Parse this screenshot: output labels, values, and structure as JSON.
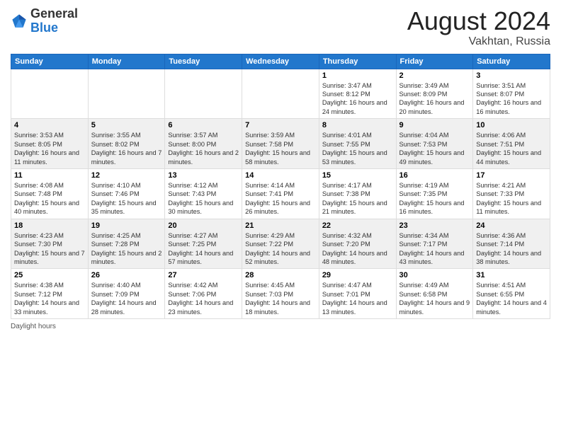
{
  "header": {
    "logo_general": "General",
    "logo_blue": "Blue",
    "month_year": "August 2024",
    "location": "Vakhtan, Russia"
  },
  "days_of_week": [
    "Sunday",
    "Monday",
    "Tuesday",
    "Wednesday",
    "Thursday",
    "Friday",
    "Saturday"
  ],
  "footer_label": "Daylight hours",
  "weeks": [
    [
      {
        "day": "",
        "info": ""
      },
      {
        "day": "",
        "info": ""
      },
      {
        "day": "",
        "info": ""
      },
      {
        "day": "",
        "info": ""
      },
      {
        "day": "1",
        "info": "Sunrise: 3:47 AM\nSunset: 8:12 PM\nDaylight: 16 hours and 24 minutes."
      },
      {
        "day": "2",
        "info": "Sunrise: 3:49 AM\nSunset: 8:09 PM\nDaylight: 16 hours and 20 minutes."
      },
      {
        "day": "3",
        "info": "Sunrise: 3:51 AM\nSunset: 8:07 PM\nDaylight: 16 hours and 16 minutes."
      }
    ],
    [
      {
        "day": "4",
        "info": "Sunrise: 3:53 AM\nSunset: 8:05 PM\nDaylight: 16 hours and 11 minutes."
      },
      {
        "day": "5",
        "info": "Sunrise: 3:55 AM\nSunset: 8:02 PM\nDaylight: 16 hours and 7 minutes."
      },
      {
        "day": "6",
        "info": "Sunrise: 3:57 AM\nSunset: 8:00 PM\nDaylight: 16 hours and 2 minutes."
      },
      {
        "day": "7",
        "info": "Sunrise: 3:59 AM\nSunset: 7:58 PM\nDaylight: 15 hours and 58 minutes."
      },
      {
        "day": "8",
        "info": "Sunrise: 4:01 AM\nSunset: 7:55 PM\nDaylight: 15 hours and 53 minutes."
      },
      {
        "day": "9",
        "info": "Sunrise: 4:04 AM\nSunset: 7:53 PM\nDaylight: 15 hours and 49 minutes."
      },
      {
        "day": "10",
        "info": "Sunrise: 4:06 AM\nSunset: 7:51 PM\nDaylight: 15 hours and 44 minutes."
      }
    ],
    [
      {
        "day": "11",
        "info": "Sunrise: 4:08 AM\nSunset: 7:48 PM\nDaylight: 15 hours and 40 minutes."
      },
      {
        "day": "12",
        "info": "Sunrise: 4:10 AM\nSunset: 7:46 PM\nDaylight: 15 hours and 35 minutes."
      },
      {
        "day": "13",
        "info": "Sunrise: 4:12 AM\nSunset: 7:43 PM\nDaylight: 15 hours and 30 minutes."
      },
      {
        "day": "14",
        "info": "Sunrise: 4:14 AM\nSunset: 7:41 PM\nDaylight: 15 hours and 26 minutes."
      },
      {
        "day": "15",
        "info": "Sunrise: 4:17 AM\nSunset: 7:38 PM\nDaylight: 15 hours and 21 minutes."
      },
      {
        "day": "16",
        "info": "Sunrise: 4:19 AM\nSunset: 7:35 PM\nDaylight: 15 hours and 16 minutes."
      },
      {
        "day": "17",
        "info": "Sunrise: 4:21 AM\nSunset: 7:33 PM\nDaylight: 15 hours and 11 minutes."
      }
    ],
    [
      {
        "day": "18",
        "info": "Sunrise: 4:23 AM\nSunset: 7:30 PM\nDaylight: 15 hours and 7 minutes."
      },
      {
        "day": "19",
        "info": "Sunrise: 4:25 AM\nSunset: 7:28 PM\nDaylight: 15 hours and 2 minutes."
      },
      {
        "day": "20",
        "info": "Sunrise: 4:27 AM\nSunset: 7:25 PM\nDaylight: 14 hours and 57 minutes."
      },
      {
        "day": "21",
        "info": "Sunrise: 4:29 AM\nSunset: 7:22 PM\nDaylight: 14 hours and 52 minutes."
      },
      {
        "day": "22",
        "info": "Sunrise: 4:32 AM\nSunset: 7:20 PM\nDaylight: 14 hours and 48 minutes."
      },
      {
        "day": "23",
        "info": "Sunrise: 4:34 AM\nSunset: 7:17 PM\nDaylight: 14 hours and 43 minutes."
      },
      {
        "day": "24",
        "info": "Sunrise: 4:36 AM\nSunset: 7:14 PM\nDaylight: 14 hours and 38 minutes."
      }
    ],
    [
      {
        "day": "25",
        "info": "Sunrise: 4:38 AM\nSunset: 7:12 PM\nDaylight: 14 hours and 33 minutes."
      },
      {
        "day": "26",
        "info": "Sunrise: 4:40 AM\nSunset: 7:09 PM\nDaylight: 14 hours and 28 minutes."
      },
      {
        "day": "27",
        "info": "Sunrise: 4:42 AM\nSunset: 7:06 PM\nDaylight: 14 hours and 23 minutes."
      },
      {
        "day": "28",
        "info": "Sunrise: 4:45 AM\nSunset: 7:03 PM\nDaylight: 14 hours and 18 minutes."
      },
      {
        "day": "29",
        "info": "Sunrise: 4:47 AM\nSunset: 7:01 PM\nDaylight: 14 hours and 13 minutes."
      },
      {
        "day": "30",
        "info": "Sunrise: 4:49 AM\nSunset: 6:58 PM\nDaylight: 14 hours and 9 minutes."
      },
      {
        "day": "31",
        "info": "Sunrise: 4:51 AM\nSunset: 6:55 PM\nDaylight: 14 hours and 4 minutes."
      }
    ]
  ]
}
